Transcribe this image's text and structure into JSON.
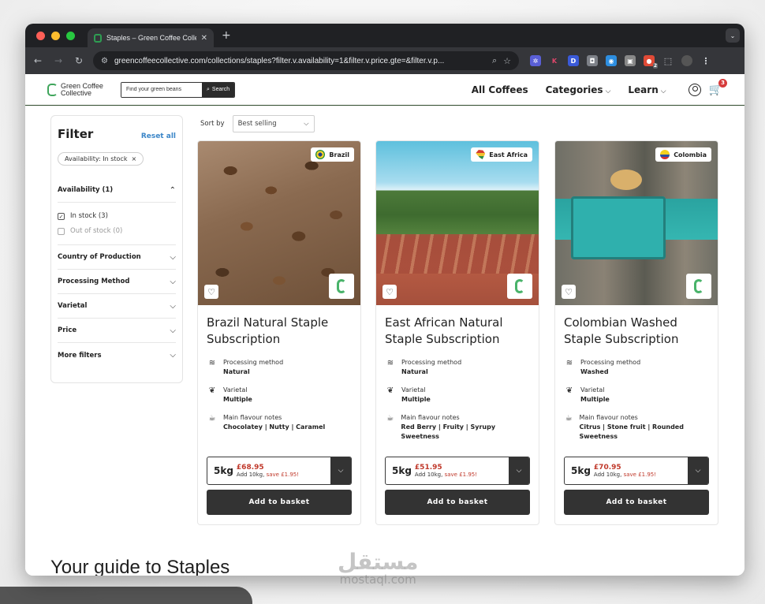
{
  "browser": {
    "tab_title": "Staples – Green Coffee Collec",
    "url": "greencoffeecollective.com/collections/staples?filter.v.availability=1&filter.v.price.gte=&filter.v.p...",
    "cart_ext_badge": "2"
  },
  "site": {
    "logo_text": "Green Coffee Collective",
    "search_placeholder": "Find your green beans",
    "search_button": "Search",
    "nav": [
      "All Coffees",
      "Categories",
      "Learn"
    ],
    "cart_count": "3"
  },
  "filter": {
    "title": "Filter",
    "reset": "Reset all",
    "active_chip": "Availability: In stock",
    "availability_label": "Availability (1)",
    "options": [
      {
        "label": "In stock (3)",
        "checked": true
      },
      {
        "label": "Out of stock (0)",
        "checked": false
      }
    ],
    "facets": [
      "Country of Production",
      "Processing Method",
      "Varietal",
      "Price",
      "More filters"
    ]
  },
  "sort": {
    "label": "Sort by",
    "value": "Best selling"
  },
  "labels": {
    "processing": "Processing method",
    "varietal": "Varietal",
    "flavour": "Main flavour notes",
    "add": "Add to basket"
  },
  "products": [
    {
      "name": "Brazil Natural Staple Subscription",
      "origin": "Brazil",
      "processing": "Natural",
      "varietal": "Multiple",
      "flavour": "Chocolatey | Nutty | Caramel",
      "size": "5kg",
      "price": "£68.95",
      "note_prefix": "Add 10kg,",
      "save": "save £1.95!"
    },
    {
      "name": "East African Natural Staple Subscription",
      "origin": "East Africa",
      "processing": "Natural",
      "varietal": "Multiple",
      "flavour": "Red Berry | Fruity | Syrupy Sweetness",
      "size": "5kg",
      "price": "£51.95",
      "note_prefix": "Add 10kg,",
      "save": "save £1.95!"
    },
    {
      "name": "Colombian Washed Staple Subscription",
      "origin": "Colombia",
      "processing": "Washed",
      "varietal": "Multiple",
      "flavour": "Citrus | Stone fruit | Rounded Sweetness",
      "size": "5kg",
      "price": "£70.95",
      "note_prefix": "Add 10kg,",
      "save": "save £1.95!"
    }
  ],
  "guide_heading": "Your guide to Staples",
  "watermark": {
    "arabic": "مستقل",
    "latin": "mostaql.com"
  },
  "colors": {
    "accent_green": "#3fa55b",
    "price_red": "#c0392b",
    "link_blue": "#3b86c8"
  }
}
